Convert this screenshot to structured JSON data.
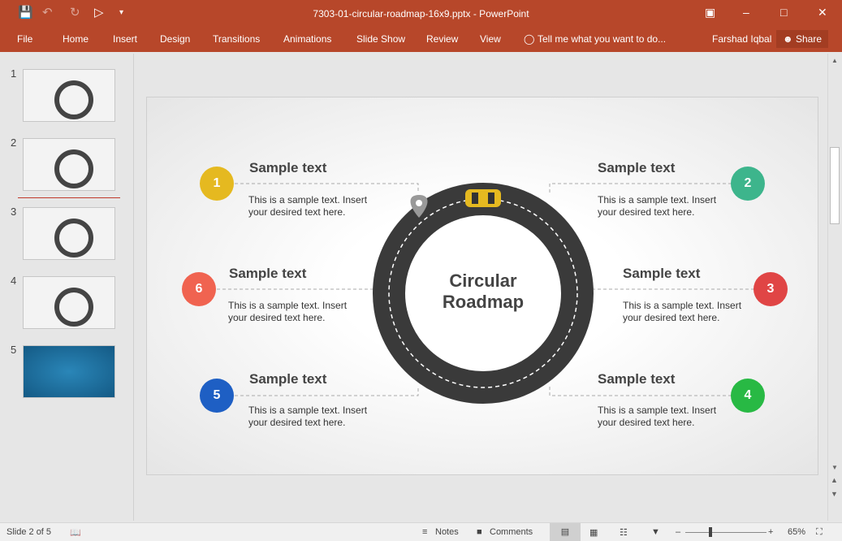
{
  "window": {
    "title": "7303-01-circular-roadmap-16x9.pptx - PowerPoint"
  },
  "ribbon": {
    "tabs": [
      "File",
      "Home",
      "Insert",
      "Design",
      "Transitions",
      "Animations",
      "Slide Show",
      "Review",
      "View"
    ],
    "tell_me": "Tell me what you want to do...",
    "user": "Farshad Iqbal",
    "share": "Share"
  },
  "thumbnails": [
    "1",
    "2",
    "3",
    "4",
    "5"
  ],
  "slide": {
    "center_title": "Circular\nRoadmap",
    "items": [
      {
        "num": "1",
        "title": "Sample text",
        "body": "This is a sample text. Insert your desired text here.",
        "color": "#e5b920"
      },
      {
        "num": "2",
        "title": "Sample text",
        "body": "This is a sample text. Insert your desired text here.",
        "color": "#3db58c"
      },
      {
        "num": "3",
        "title": "Sample text",
        "body": "This is a sample text. Insert your desired text here.",
        "color": "#e04545"
      },
      {
        "num": "4",
        "title": "Sample text",
        "body": "This is a sample text. Insert your desired text here.",
        "color": "#28b944"
      },
      {
        "num": "5",
        "title": "Sample text",
        "body": "This is a sample text. Insert your desired text here.",
        "color": "#1e5fc4"
      },
      {
        "num": "6",
        "title": "Sample text",
        "body": "This is a sample text. Insert your desired text here.",
        "color": "#f06350"
      }
    ]
  },
  "status": {
    "slide": "Slide 2 of 5",
    "notes": "Notes",
    "comments": "Comments",
    "zoom": "65%",
    "zoom_level_percent": 65
  }
}
